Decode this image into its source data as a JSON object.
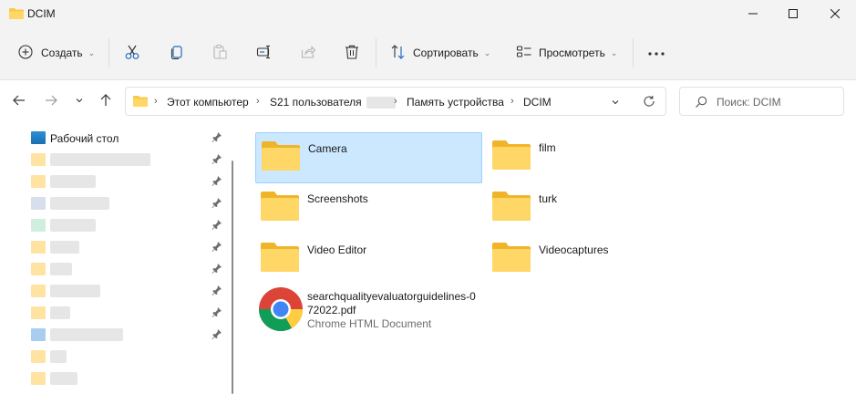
{
  "window": {
    "title": "DCIM"
  },
  "commands": {
    "create": "Создать",
    "sort": "Сортировать",
    "view": "Просмотреть"
  },
  "address": {
    "crumbs": [
      "Этот компьютер",
      "S21 пользователя",
      "Память устройства",
      "DCIM"
    ],
    "search_placeholder": "Поиск: DCIM"
  },
  "sidebar": {
    "items": [
      {
        "label": "Рабочий стол",
        "icon": "desktop-icon",
        "pinned": true
      },
      {
        "label": "",
        "icon": "folder-icon",
        "pinned": true
      },
      {
        "label": "",
        "icon": "folder-icon",
        "pinned": true
      },
      {
        "label": "",
        "icon": "documents-icon",
        "pinned": true
      },
      {
        "label": "",
        "icon": "pictures-icon",
        "pinned": true
      },
      {
        "label": "",
        "icon": "folder-icon",
        "pinned": true
      },
      {
        "label": "",
        "icon": "folder-icon",
        "pinned": true
      },
      {
        "label": "",
        "icon": "folder-icon",
        "pinned": true
      },
      {
        "label": "",
        "icon": "folder-icon",
        "pinned": true
      },
      {
        "label": "",
        "icon": "drive-icon",
        "pinned": true
      },
      {
        "label": "",
        "icon": "folder-icon",
        "pinned": false
      },
      {
        "label": "",
        "icon": "folder-icon",
        "pinned": false
      }
    ]
  },
  "content": {
    "folders": [
      "Camera",
      "film",
      "Screenshots",
      "turk",
      "Video Editor",
      "Videocaptures"
    ],
    "selected": "Camera",
    "file": {
      "name": "searchqualityevaluatorguidelines-0\n72022.pdf",
      "type": "Chrome HTML Document",
      "icon": "chrome-icon"
    }
  },
  "colors": {
    "folder": "#f8c94a",
    "selection": "#cce8ff",
    "accent": "#0067c0"
  }
}
